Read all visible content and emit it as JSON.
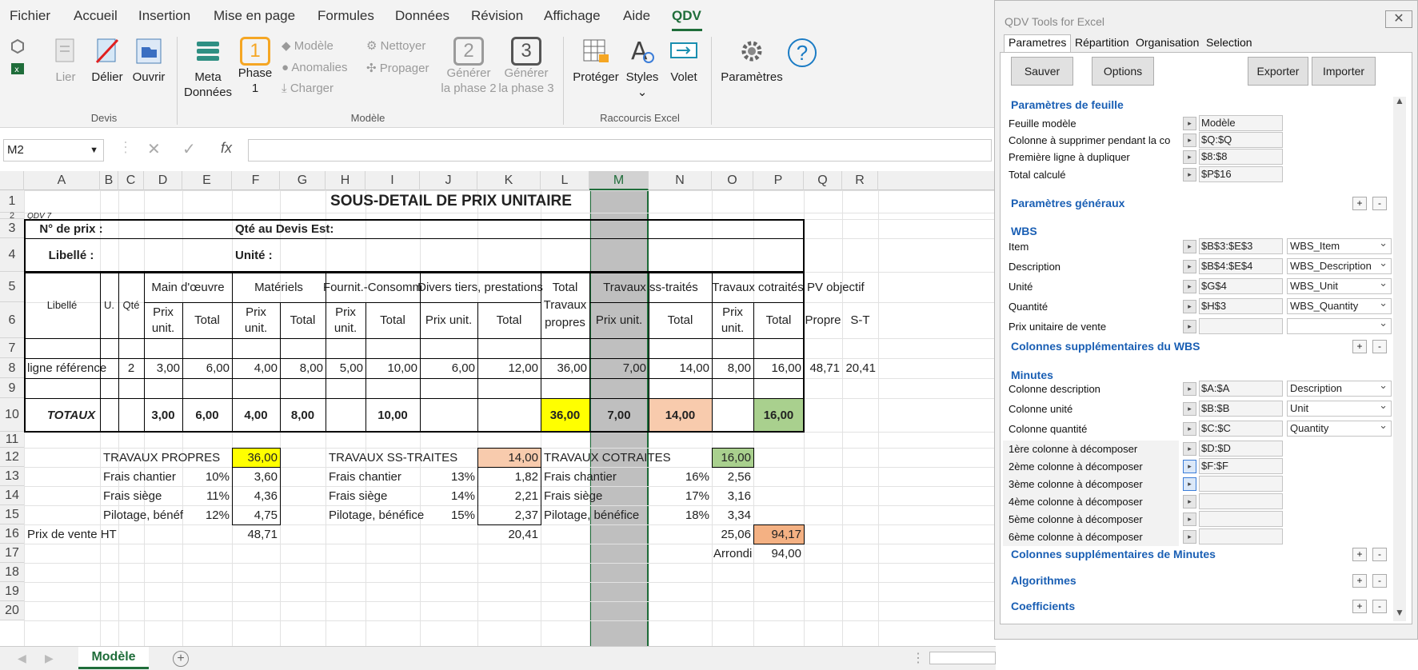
{
  "menu": [
    "Fichier",
    "Accueil",
    "Insertion",
    "Mise en page",
    "Formules",
    "Données",
    "Révision",
    "Affichage",
    "Aide",
    "QDV"
  ],
  "ribbon": {
    "devis": {
      "group": "Devis",
      "lier": "Lier",
      "delier": "Délier",
      "ouvrir": "Ouvrir"
    },
    "modele": {
      "group": "Modèle",
      "meta1": "Meta",
      "meta2": "Données",
      "phase1a": "Phase",
      "phase1b": "1",
      "phase1_num": "1",
      "modele": "Modèle",
      "anomalies": "Anomalies",
      "charger": "Charger",
      "nettoyer": "Nettoyer",
      "propager": "Propager",
      "gen2a": "Générer",
      "gen2b": "la phase 2",
      "gen2_num": "2",
      "gen3a": "Générer",
      "gen3b": "la phase 3",
      "gen3_num": "3"
    },
    "raccourcis": {
      "group": "Raccourcis Excel",
      "proteger": "Protéger",
      "styles": "Styles",
      "volet": "Volet"
    },
    "parametres": "Paramètres"
  },
  "formula_bar": {
    "name_box": "M2",
    "fx": "fx",
    "formula": ""
  },
  "columns": [
    "A",
    "B",
    "C",
    "D",
    "E",
    "F",
    "G",
    "H",
    "I",
    "J",
    "K",
    "L",
    "M",
    "N",
    "O",
    "P",
    "Q",
    "R"
  ],
  "rows": [
    "1",
    "2",
    "3",
    "4",
    "5",
    "6",
    "7",
    "8",
    "9",
    "10",
    "11",
    "12",
    "13",
    "14",
    "15",
    "16",
    "17",
    "18",
    "19",
    "20"
  ],
  "sheet": {
    "title": "SOUS-DETAIL DE PRIX UNITAIRE",
    "qdv7": "QDV 7",
    "no_prix": "N° de prix :",
    "qte_devis": "Qté au Devis Est:",
    "libelle": "Libellé :",
    "unite": "Unité :",
    "h_libelle": "Libellé",
    "h_u": "U.",
    "h_qte": "Qté",
    "h_mo": "Main d'œuvre",
    "h_mat": "Matériels",
    "h_fourn": "Fournit.-Consomm",
    "h_divers": "Divers tiers, prestations",
    "h_total_tp1": "Total",
    "h_total_tp2": "Travaux",
    "h_total_tp3": "propres",
    "h_ss": "Travaux ss-traités",
    "h_cot": "Travaux cotraités",
    "h_pv": "PV objectif",
    "h_prix": "Prix",
    "h_unit": "unit.",
    "h_total": "Total",
    "h_prixunit": "Prix unit.",
    "h_propre": "Propre",
    "h_st": "S-T",
    "r8": [
      "ligne référence",
      "2",
      "3,00",
      "6,00",
      "4,00",
      "8,00",
      "5,00",
      "10,00",
      "6,00",
      "12,00",
      "36,00",
      "7,00",
      "14,00",
      "8,00",
      "16,00",
      "48,71",
      "20,41"
    ],
    "totaux_label": "TOTAUX",
    "r10": [
      "3,00",
      "6,00",
      "4,00",
      "8,00",
      "10,00",
      "36,00",
      "7,00",
      "14,00",
      "16,00"
    ],
    "tp": "TRAVAUX PROPRES",
    "tp_val": "36,00",
    "ss": "TRAVAUX SS-TRAITES",
    "ss_val": "14,00",
    "cot": "TRAVAUX COTRAITES",
    "cot_val": "16,00",
    "fc": "Frais chantier",
    "fs": "Frais siège",
    "pb1": "Pilotage, bénéf",
    "pb2": "Pilotage, bénéfice",
    "tp_pct": [
      "10%",
      "11%",
      "12%"
    ],
    "tp_vals": [
      "3,60",
      "4,36",
      "4,75"
    ],
    "ss_pct": [
      "13%",
      "14%",
      "15%"
    ],
    "ss_vals": [
      "1,82",
      "2,21",
      "2,37"
    ],
    "cot_pct": [
      "16%",
      "17%",
      "18%"
    ],
    "cot_vals": [
      "2,56",
      "3,16",
      "3,34"
    ],
    "pv_ht": "Prix de vente HT",
    "pv_tp": "48,71",
    "pv_ss": "20,41",
    "pv_cot": "25,06",
    "pv_total": "94,17",
    "arrondi": "Arrondi",
    "arrondi_val": "94,00"
  },
  "sheet_tab": "Modèle",
  "panel": {
    "title": "QDV Tools for Excel",
    "tabs": [
      "Parametres",
      "Répartition",
      "Organisation",
      "Selection"
    ],
    "buttons": {
      "sauver": "Sauver",
      "options": "Options",
      "exporter": "Exporter",
      "importer": "Importer"
    },
    "s_feuille": "Paramètres de feuille",
    "feuille": [
      {
        "label": "Feuille modèle",
        "value": "Modèle"
      },
      {
        "label": "Colonne à supprimer pendant la co",
        "value": "$Q:$Q"
      },
      {
        "label": "Première ligne à dupliquer",
        "value": "$8:$8"
      },
      {
        "label": "Total calculé",
        "value": "$P$16"
      }
    ],
    "s_generaux": "Paramètres généraux",
    "s_wbs": "WBS",
    "wbs": [
      {
        "label": "Item",
        "value": "$B$3:$E$3",
        "sel": "WBS_Item"
      },
      {
        "label": "Description",
        "value": "$B$4:$E$4",
        "sel": "WBS_Description"
      },
      {
        "label": "Unité",
        "value": "$G$4",
        "sel": "WBS_Unit"
      },
      {
        "label": "Quantité",
        "value": "$H$3",
        "sel": "WBS_Quantity"
      },
      {
        "label": "Prix unitaire de vente",
        "value": "",
        "sel": ""
      }
    ],
    "s_wbs_sup": "Colonnes supplémentaires du WBS",
    "s_minutes": "Minutes",
    "minutes": [
      {
        "label": "Colonne description",
        "value": "$A:$A",
        "sel": "Description"
      },
      {
        "label": "Colonne unité",
        "value": "$B:$B",
        "sel": "Unit"
      },
      {
        "label": "Colonne quantité",
        "value": "$C:$C",
        "sel": "Quantity"
      }
    ],
    "decomp": [
      {
        "label": "1ère colonne à décomposer",
        "value": "$D:$D"
      },
      {
        "label": "2ème colonne à décomposer",
        "value": "$F:$F"
      },
      {
        "label": "3ème colonne à décomposer",
        "value": ""
      },
      {
        "label": "4ème colonne à décomposer",
        "value": ""
      },
      {
        "label": "5ème colonne à décomposer",
        "value": ""
      },
      {
        "label": "6ème colonne à décomposer",
        "value": ""
      }
    ],
    "s_min_sup": "Colonnes supplémentaires de Minutes",
    "s_algo": "Algorithmes",
    "s_coef": "Coefficients",
    "plus": "+",
    "minus": "-"
  },
  "colors": {
    "accent": "#1f6d3a",
    "yellow": "#ffff00",
    "peach": "#f8cbad",
    "green": "#a9d08e",
    "orange": "#f4b183",
    "selected_col": "#bfbfbf",
    "panel_link": "#1a5fb4"
  }
}
